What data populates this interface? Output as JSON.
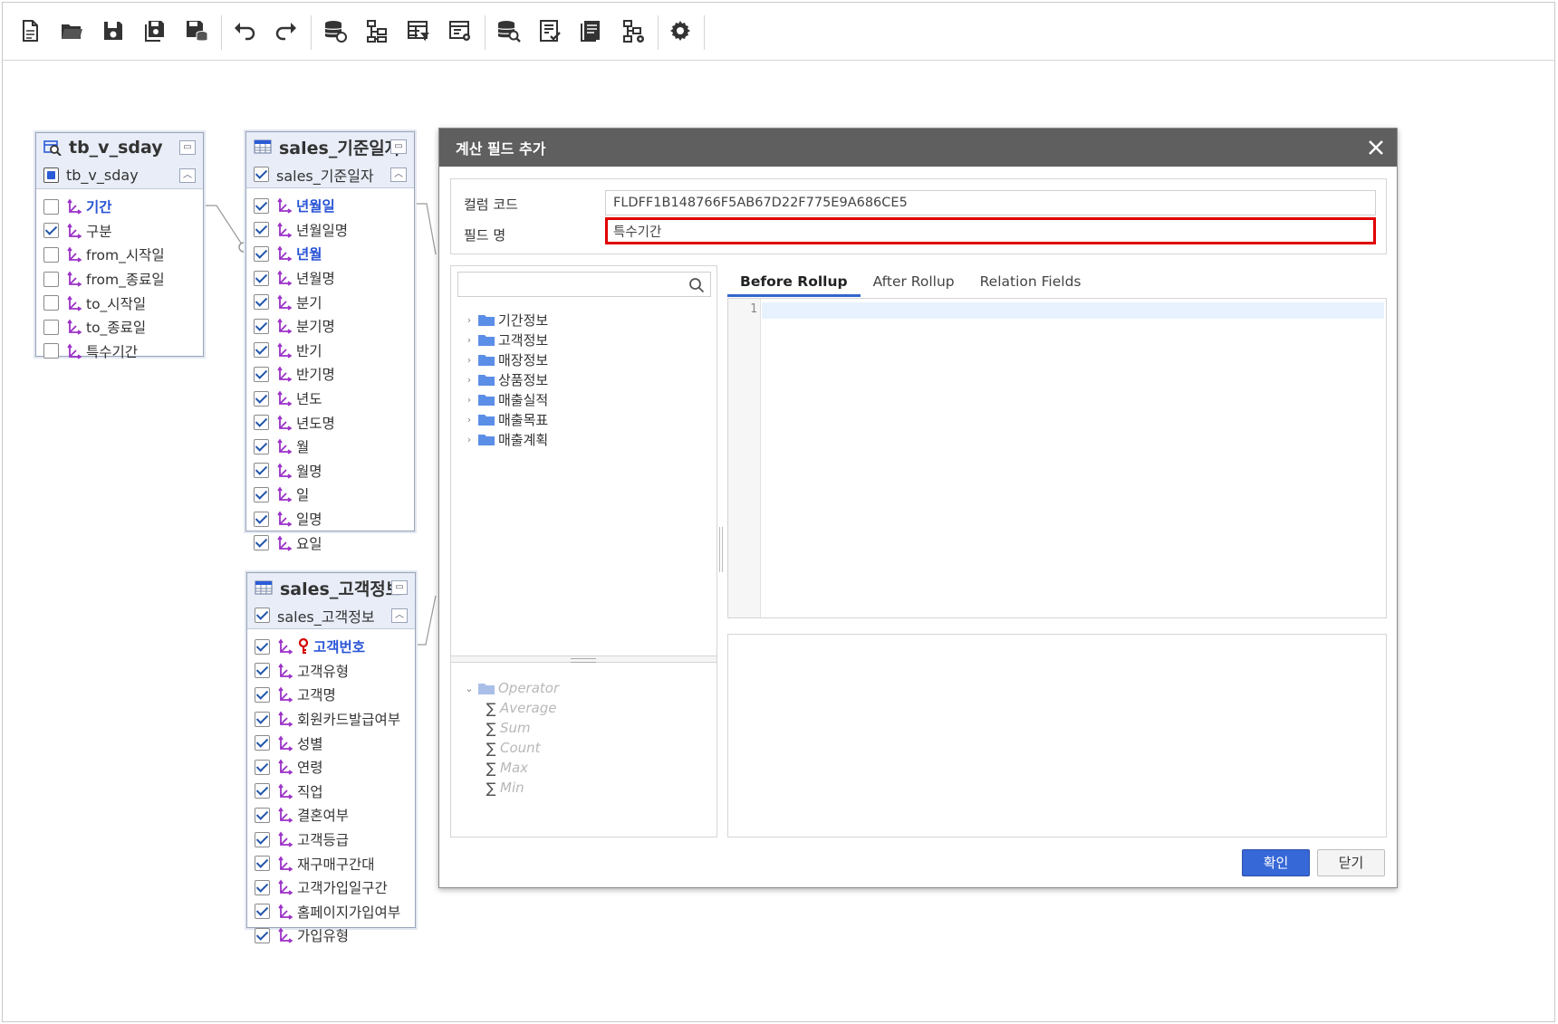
{
  "toolbar": {
    "buttons": [
      "new-file",
      "open-folder",
      "save",
      "save-as",
      "save-db",
      "undo",
      "redo",
      "datasource",
      "hierarchy",
      "table-filter",
      "window-settings",
      "db-search",
      "checklist",
      "report",
      "hierarchy-settings",
      "settings"
    ]
  },
  "entities": {
    "tb_v_sday": {
      "title": "tb_v_sday",
      "subtitle": "tb_v_sday",
      "rows": [
        {
          "label": "기간",
          "checked": false,
          "key": true
        },
        {
          "label": "구분",
          "checked": true
        },
        {
          "label": "from_시작일",
          "checked": false
        },
        {
          "label": "from_종료일",
          "checked": false
        },
        {
          "label": "to_시작일",
          "checked": false
        },
        {
          "label": "to_종료일",
          "checked": false
        },
        {
          "label": "특수기간",
          "checked": false
        }
      ]
    },
    "sales_date": {
      "title": "sales_기준일자",
      "subtitle": "sales_기준일자",
      "rows": [
        {
          "label": "년월일",
          "key": true
        },
        {
          "label": "년월일명"
        },
        {
          "label": "년월",
          "key": true
        },
        {
          "label": "년월명"
        },
        {
          "label": "분기"
        },
        {
          "label": "분기명"
        },
        {
          "label": "반기"
        },
        {
          "label": "반기명"
        },
        {
          "label": "년도"
        },
        {
          "label": "년도명"
        },
        {
          "label": "월"
        },
        {
          "label": "월명"
        },
        {
          "label": "일"
        },
        {
          "label": "일명"
        },
        {
          "label": "요일"
        }
      ]
    },
    "sales_customer": {
      "title": "sales_고객정보",
      "subtitle": "sales_고객정보",
      "rows": [
        {
          "label": "고객번호",
          "key": true,
          "pk": true
        },
        {
          "label": "고객유형"
        },
        {
          "label": "고객명"
        },
        {
          "label": "회원카드발급여부"
        },
        {
          "label": "성별"
        },
        {
          "label": "연령"
        },
        {
          "label": "직업"
        },
        {
          "label": "결혼여부"
        },
        {
          "label": "고객등급"
        },
        {
          "label": "재구매구간대"
        },
        {
          "label": "고객가입일구간"
        },
        {
          "label": "홈페이지가입여부"
        },
        {
          "label": "가입유형"
        }
      ]
    }
  },
  "dialog": {
    "title": "계산 필드 추가",
    "column_code_label": "컬럼 코드",
    "column_code_value": "FLDFF1B148766F5AB67D22F775E9A686CE5",
    "field_name_label": "필드 명",
    "field_name_value": "특수기간",
    "search_placeholder": "",
    "tree": [
      "기간정보",
      "고객정보",
      "매장정보",
      "상품정보",
      "매출실적",
      "매출목표",
      "매출계획"
    ],
    "operator_root": "Operator",
    "operators": [
      "Average",
      "Sum",
      "Count",
      "Max",
      "Min"
    ],
    "tabs": [
      "Before Rollup",
      "After Rollup",
      "Relation Fields"
    ],
    "active_tab": "Before Rollup",
    "editor_line": "1",
    "ok_label": "확인",
    "close_label": "닫기"
  },
  "colors": {
    "accent": "#3768d8",
    "highlight_border": "#e00000",
    "dialog_header": "#5f5f5f",
    "field_icon": "#9b30c8",
    "key_label": "#2a55d6"
  }
}
